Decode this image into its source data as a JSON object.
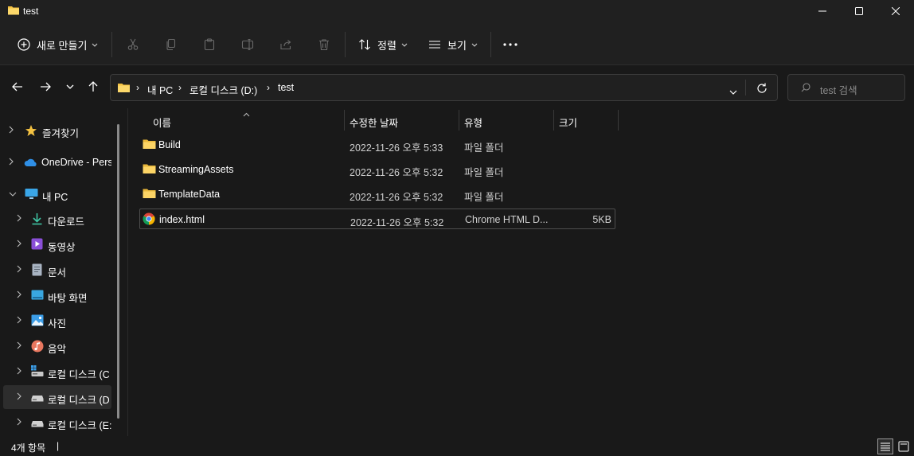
{
  "window": {
    "title": "test"
  },
  "toolbar": {
    "new_label": "새로 만들기",
    "sort_label": "정렬",
    "view_label": "보기"
  },
  "address": {
    "crumbs": [
      "내 PC",
      "로컬 디스크 (D:)",
      "test"
    ]
  },
  "search": {
    "placeholder": "test 검색"
  },
  "sidebar": {
    "items": [
      {
        "label": "즐겨찾기",
        "icon": "star-icon"
      },
      {
        "label": "OneDrive - Perso",
        "icon": "onedrive-icon"
      },
      {
        "label": "내 PC",
        "icon": "pc-icon"
      },
      {
        "label": "다운로드",
        "icon": "download-icon"
      },
      {
        "label": "동영상",
        "icon": "video-icon"
      },
      {
        "label": "문서",
        "icon": "document-icon"
      },
      {
        "label": "바탕 화면",
        "icon": "desktop-icon"
      },
      {
        "label": "사진",
        "icon": "pictures-icon"
      },
      {
        "label": "음악",
        "icon": "music-icon"
      },
      {
        "label": "로컬 디스크 (C",
        "icon": "system-drive-icon"
      },
      {
        "label": "로컬 디스크 (D",
        "icon": "drive-icon"
      },
      {
        "label": "로컬 디스크 (E:",
        "icon": "drive-icon"
      }
    ]
  },
  "columns": {
    "name": "이름",
    "date": "수정한 날짜",
    "type": "유형",
    "size": "크기"
  },
  "files": [
    {
      "name": "Build",
      "date": "2022-11-26 오후 5:33",
      "type": "파일 폴더",
      "size": "",
      "icon": "folder-icon"
    },
    {
      "name": "StreamingAssets",
      "date": "2022-11-26 오후 5:32",
      "type": "파일 폴더",
      "size": "",
      "icon": "folder-icon"
    },
    {
      "name": "TemplateData",
      "date": "2022-11-26 오후 5:32",
      "type": "파일 폴더",
      "size": "",
      "icon": "folder-icon"
    },
    {
      "name": "index.html",
      "date": "2022-11-26 오후 5:32",
      "type": "Chrome HTML D...",
      "size": "5KB",
      "icon": "chrome-icon"
    }
  ],
  "status": {
    "count": "4개 항목",
    "cursor": "|"
  },
  "colors": {
    "background": "#191919",
    "chrome": "#202020",
    "folder": "#f4c242"
  }
}
